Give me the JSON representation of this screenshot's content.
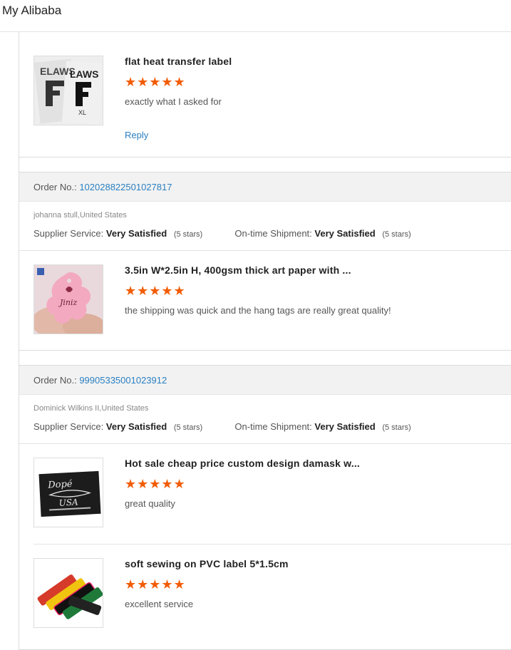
{
  "app": {
    "title": "My Alibaba"
  },
  "colors": {
    "star": "#f25c05",
    "link": "#2a7fc1"
  },
  "labels": {
    "order_no": "Order No.:",
    "supplier_service": "Supplier Service:",
    "on_time_shipment": "On-time Shipment:",
    "reply": "Reply"
  },
  "first_item": {
    "title": "flat heat transfer label",
    "stars": "★★★★★",
    "comment": "exactly what I asked for",
    "rating": 5
  },
  "orders": [
    {
      "order_number": "102028822501027817",
      "buyer": "johanna stull,United States",
      "supplier_service": "Very Satisfied",
      "supplier_stars": "(5 stars)",
      "shipment": "Very Satisfied",
      "shipment_stars": "(5 stars)",
      "items": [
        {
          "title": "3.5in W*2.5in H, 400gsm thick art paper with ...",
          "stars": "★★★★★",
          "comment": "the shipping was quick and the hang tags are really great quality!",
          "rating": 5
        }
      ]
    },
    {
      "order_number": "99905335001023912",
      "buyer": "Dominick Wilkins II,United States",
      "supplier_service": "Very Satisfied",
      "supplier_stars": "(5 stars)",
      "shipment": "Very Satisfied",
      "shipment_stars": "(5 stars)",
      "items": [
        {
          "title": "Hot sale cheap price custom design damask w...",
          "stars": "★★★★★",
          "comment": "great quality",
          "rating": 5
        },
        {
          "title": "soft sewing on PVC label 5*1.5cm",
          "stars": "★★★★★",
          "comment": "excellent service",
          "rating": 5
        }
      ]
    }
  ]
}
